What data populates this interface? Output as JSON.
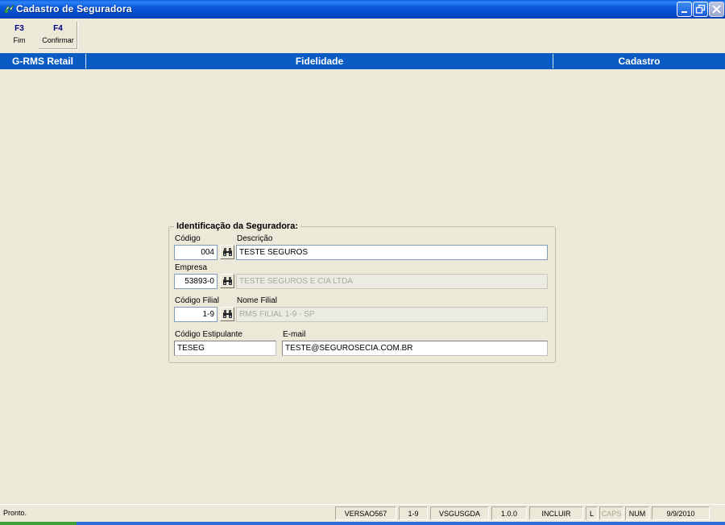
{
  "window": {
    "title": "Cadastro de Seguradora",
    "app_icon": "rms-app-icon",
    "controls": {
      "minimize_icon": "minimize-icon",
      "restore_icon": "restore-icon",
      "close_icon": "close-icon"
    }
  },
  "toolbar": {
    "buttons": [
      {
        "key": "F3",
        "label": "Fim"
      },
      {
        "key": "F4",
        "label": "Confirmar"
      }
    ]
  },
  "header": {
    "system": "G-RMS Retail",
    "module": "Fidelidade",
    "screen": "Cadastro"
  },
  "form": {
    "group_title": "Identificação da Seguradora:",
    "codigo": {
      "label": "Código",
      "value": "004"
    },
    "descricao": {
      "label": "Descrição",
      "value": "TESTE SEGUROS"
    },
    "empresa": {
      "label": "Empresa",
      "value": "53893-0",
      "description": "TESTE SEGUROS E CIA LTDA"
    },
    "codigo_filial": {
      "label": "Código Filial",
      "value": "1-9"
    },
    "nome_filial": {
      "label": "Nome Filial",
      "value": "RMS FILIAL 1-9 - SP"
    },
    "codigo_estipulante": {
      "label": "Código Estipulante",
      "value": "TESEG"
    },
    "email": {
      "label": "E-mail",
      "value": "TESTE@SEGUROSECIA.COM.BR"
    },
    "search_icon": "binoculars-icon"
  },
  "statusbar": {
    "message": "Pronto.",
    "version": "VERSAO567",
    "filial": "1-9",
    "program": "VSGUSGDA",
    "release": "1.0.0",
    "mode": "INCLUIR",
    "l_indicator": "L",
    "caps": "CAPS",
    "num": "NUM",
    "date": "9/9/2010"
  },
  "colors": {
    "titlebar": "#0a58d8",
    "header_band": "#0a5cc4",
    "window_bg": "#ece9d8",
    "toolbar_key": "#000080"
  }
}
